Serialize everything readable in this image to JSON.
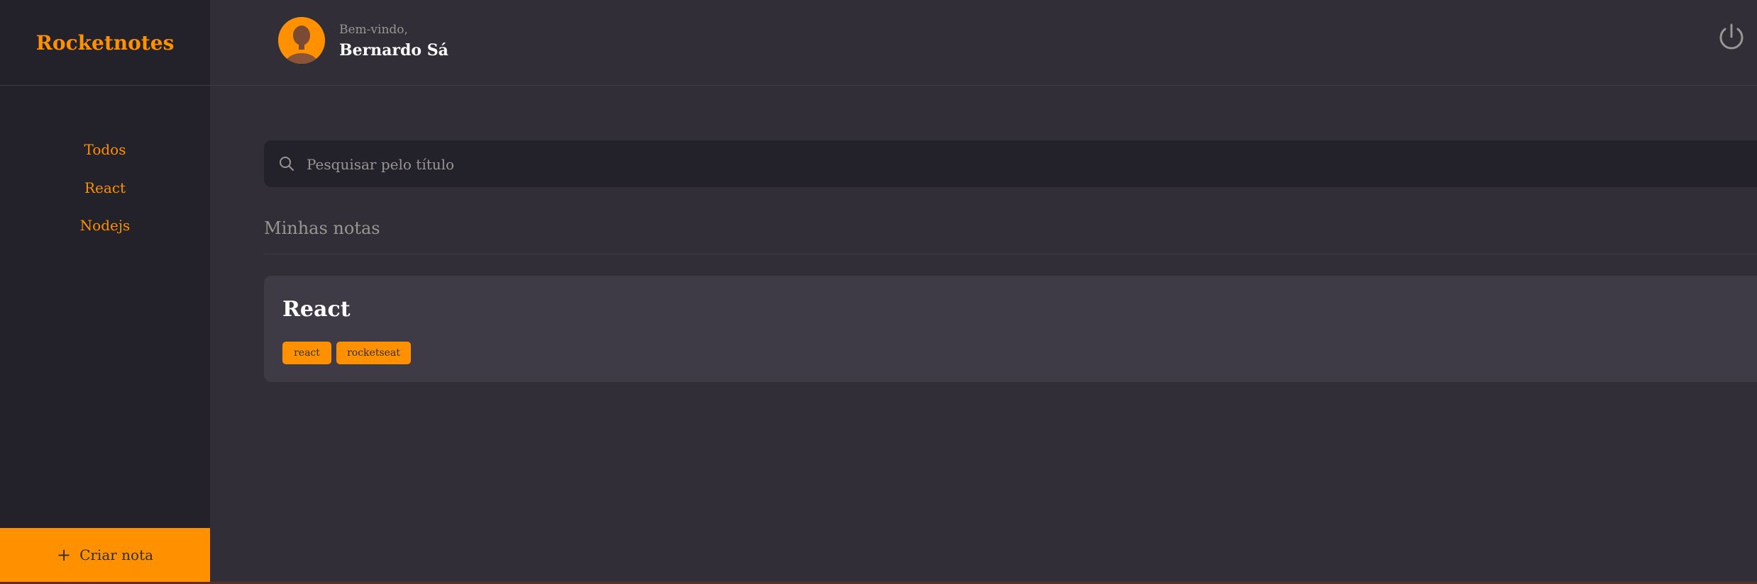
{
  "brand": {
    "title": "Rocketnotes"
  },
  "sidebar": {
    "items": [
      {
        "label": "Todos"
      },
      {
        "label": "React"
      },
      {
        "label": "Nodejs"
      }
    ],
    "create_label": "Criar nota"
  },
  "header": {
    "welcome": "Bem-vindo,",
    "user_name": "Bernardo Sá"
  },
  "search": {
    "placeholder": "Pesquisar pelo título"
  },
  "section": {
    "title": "Minhas notas"
  },
  "notes": [
    {
      "title": "React",
      "tags": [
        "react",
        "rocketseat"
      ]
    }
  ],
  "colors": {
    "accent": "#ff9000",
    "background": "#312e38",
    "sidebar": "#232129",
    "card": "#3e3b47",
    "muted_text": "#999591"
  },
  "icons": {
    "plus": "plus-icon",
    "search": "search-icon",
    "logout": "power-icon",
    "avatar": "avatar"
  }
}
